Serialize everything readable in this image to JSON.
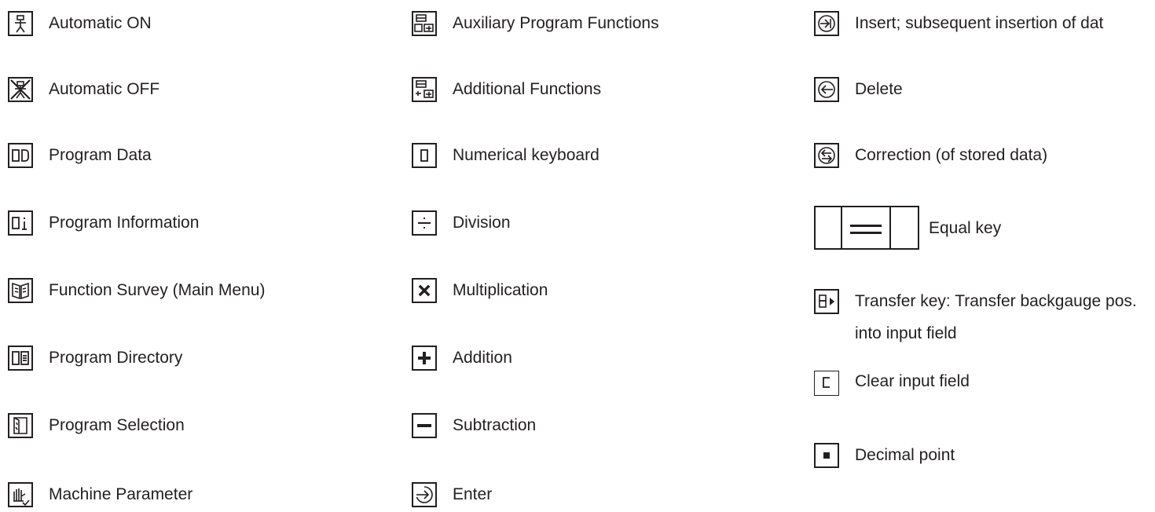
{
  "legend": {
    "column1": [
      {
        "label": "Automatic ON",
        "icon": "automatic-on-icon"
      },
      {
        "label": "Automatic OFF",
        "icon": "automatic-off-icon"
      },
      {
        "label": "Program Data",
        "icon": "program-data-icon"
      },
      {
        "label": "Program Information",
        "icon": "program-information-icon"
      },
      {
        "label": "Function Survey (Main Menu)",
        "icon": "function-survey-icon"
      },
      {
        "label": "Program Directory",
        "icon": "program-directory-icon"
      },
      {
        "label": "Program Selection",
        "icon": "program-selection-icon"
      },
      {
        "label": "Machine Parameter",
        "icon": "machine-parameter-icon"
      }
    ],
    "column2": [
      {
        "label": "Auxiliary Program Functions",
        "icon": "auxiliary-program-functions-icon"
      },
      {
        "label": "Additional Functions",
        "icon": "additional-functions-icon"
      },
      {
        "label": "Numerical keyboard",
        "icon": "numerical-keyboard-icon"
      },
      {
        "label": "Division",
        "icon": "division-icon"
      },
      {
        "label": "Multiplication",
        "icon": "multiplication-icon"
      },
      {
        "label": "Addition",
        "icon": "addition-icon"
      },
      {
        "label": "Subtraction",
        "icon": "subtraction-icon"
      },
      {
        "label": "Enter",
        "icon": "enter-icon"
      }
    ],
    "column3": [
      {
        "label": "Insert; subsequent insertion of dat",
        "icon": "insert-icon"
      },
      {
        "label": "Delete",
        "icon": "delete-icon"
      },
      {
        "label": "Correction (of stored data)",
        "icon": "correction-icon"
      },
      {
        "label": "Equal key",
        "icon": "equal-key-icon"
      },
      {
        "label": "Transfer key: Transfer backgauge pos. into input field",
        "icon": "transfer-key-icon"
      },
      {
        "label": "Clear input field",
        "icon": "clear-input-icon"
      },
      {
        "label": "Decimal point",
        "icon": "decimal-point-icon"
      }
    ]
  },
  "colors": {
    "ink": "#231f20",
    "background": "#ffffff"
  }
}
